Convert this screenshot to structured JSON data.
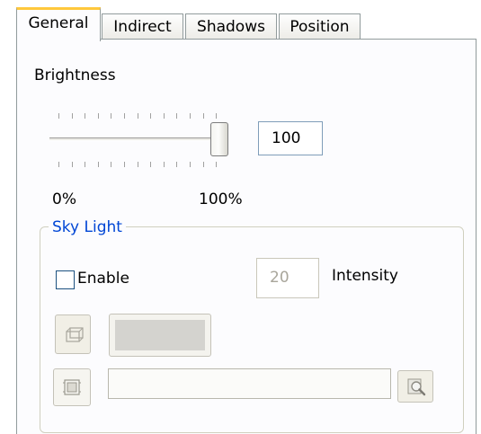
{
  "tabs": [
    {
      "label": "General",
      "active": true
    },
    {
      "label": "Indirect",
      "active": false
    },
    {
      "label": "Shadows",
      "active": false
    },
    {
      "label": "Position",
      "active": false
    }
  ],
  "brightness": {
    "label": "Brightness",
    "value": "100",
    "slider_fraction": 1.0,
    "min_label": "0%",
    "max_label": "100%"
  },
  "sky_light": {
    "title": "Sky Light",
    "enable_label": "Enable",
    "enable_checked": false,
    "intensity_value": "20",
    "intensity_label": "Intensity",
    "color_button_icon": "color-box-icon",
    "texture_button_icon": "texture-image-icon",
    "browse_icon": "magnifier-browse-icon",
    "texture_path": ""
  },
  "colors": {
    "active_tab_accent": "#ffc83c",
    "group_title": "#0046d5"
  }
}
